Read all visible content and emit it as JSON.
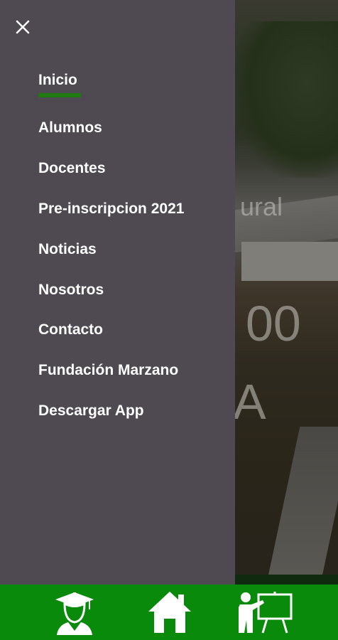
{
  "drawer": {
    "close_icon": "close-icon",
    "active_indicator_color": "#1f7a10",
    "items": [
      {
        "label": "Inicio",
        "active": true
      },
      {
        "label": "Alumnos"
      },
      {
        "label": "Docentes"
      },
      {
        "label": "Pre-inscripcion 2021"
      },
      {
        "label": "Noticias"
      },
      {
        "label": "Nosotros"
      },
      {
        "label": "Contacto"
      },
      {
        "label": "Fundación Marzano"
      },
      {
        "label": "Descargar App"
      }
    ]
  },
  "background": {
    "text1": "ural",
    "text2": "00",
    "text3": "A"
  },
  "bottom_nav": {
    "color": "#0a8a0a",
    "buttons": [
      {
        "icon": "graduate-icon"
      },
      {
        "icon": "home-icon"
      },
      {
        "icon": "teacher-board-icon"
      }
    ]
  }
}
